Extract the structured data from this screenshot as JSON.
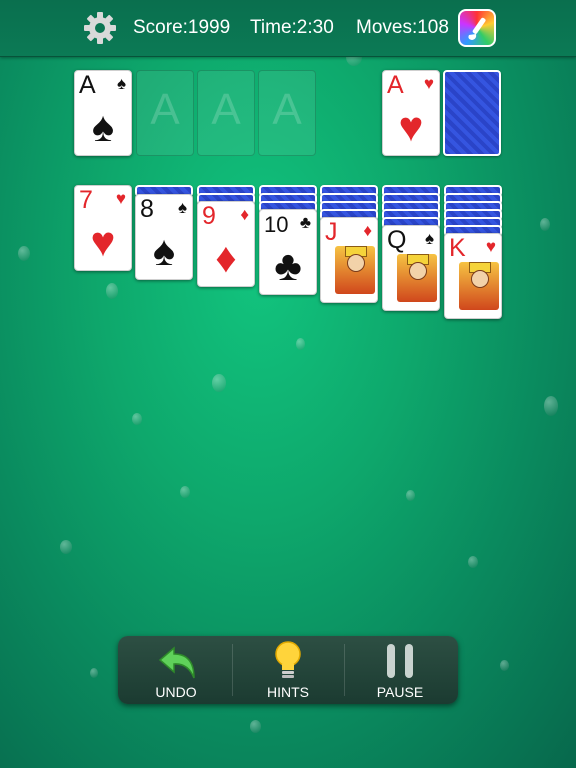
{
  "header": {
    "settings_icon": "gear-icon",
    "score": "Score:1999",
    "time": "Time:2:30",
    "moves": "Moves:108",
    "theme_icon": "theme-brush-icon"
  },
  "foundations": [
    {
      "rank": "A",
      "suit": "♠",
      "color": "black"
    },
    {
      "placeholder": "A"
    },
    {
      "placeholder": "A"
    },
    {
      "placeholder": "A"
    }
  ],
  "waste": {
    "rank": "A",
    "suit": "♥",
    "color": "red"
  },
  "stock": {
    "label": "stock-pile"
  },
  "tableau": [
    {
      "hidden": 0,
      "rank": "7",
      "suit": "♥",
      "color": "red"
    },
    {
      "hidden": 1,
      "rank": "8",
      "suit": "♠",
      "color": "black"
    },
    {
      "hidden": 2,
      "rank": "9",
      "suit": "♦",
      "color": "red"
    },
    {
      "hidden": 3,
      "rank": "10",
      "suit": "♣",
      "color": "black"
    },
    {
      "hidden": 4,
      "rank": "J",
      "suit": "♦",
      "color": "red"
    },
    {
      "hidden": 5,
      "rank": "Q",
      "suit": "♠",
      "color": "black"
    },
    {
      "hidden": 6,
      "rank": "K",
      "suit": "♥",
      "color": "red"
    }
  ],
  "toolbar": {
    "undo": "UNDO",
    "hints": "HINTS",
    "pause": "PAUSE"
  }
}
